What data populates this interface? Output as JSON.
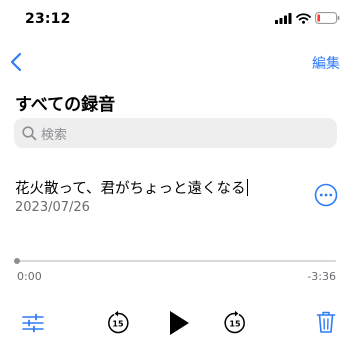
{
  "status_bar": {
    "time": "23:12",
    "icons": [
      "signal-icon",
      "wifi-icon",
      "battery-low-icon"
    ]
  },
  "nav": {
    "back_icon": "chevron-left-icon",
    "edit_label": "編集"
  },
  "page": {
    "title": "すべての録音"
  },
  "search": {
    "placeholder": "検索"
  },
  "recording": {
    "title": "花火散って、君がちょっと遠くなる",
    "date": "2023/07/26",
    "more_icon": "ellipsis-circle-icon"
  },
  "playback": {
    "current_time": "0:00",
    "remaining_time": "-3:36",
    "progress": 0,
    "skip_back_seconds": "15",
    "skip_forward_seconds": "15"
  },
  "colors": {
    "accent": "#2f7cf6",
    "battery_low": "#ff3b30"
  }
}
